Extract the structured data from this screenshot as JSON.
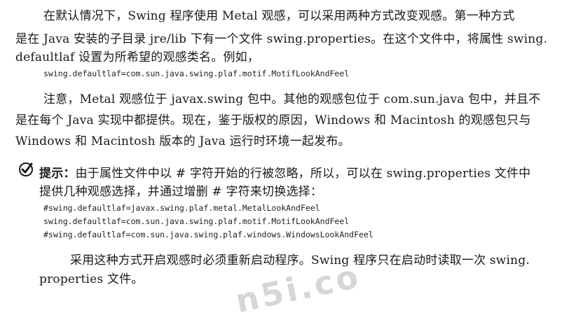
{
  "paragraph1": {
    "line1": "在默认情况下，Swing 程序使用 Metal 观感，可以采用两种方式改变观感。第一种方式",
    "line2": "是在 Java 安装的子目录 jre/lib 下有一个文件 swing.properties。在这个文件中，将属性 swing.",
    "line3": "defaultlaf 设置为所希望的观感类名。例如，"
  },
  "code1": "swing.defaultlaf=com.sun.java.swing.plaf.motif.MotifLookAndFeel",
  "paragraph2": {
    "line1": "注意，Metal 观感位于 javax.swing 包中。其他的观感包位于 com.sun.java 包中，并且不",
    "line2": "是在每个 Java 实现中都提供。现在，鉴于版权的原因，Windows 和 Macintosh 的观感包只与",
    "line3": "Windows 和 Macintosh 版本的 Java 运行时环境一起发布。"
  },
  "tip": {
    "icon": "checkmark-icon",
    "title": "提示：",
    "line1": "由于属性文件中以 # 字符开始的行被忽略，所以，可以在 swing.properties 文件中",
    "line2": "提供几种观感选择，并通过增删 # 字符来切换选择：",
    "code": [
      "#swing.defaultlaf=javax.swing.plaf.metal.MetalLookAndFeel",
      "swing.defaultlaf=com.sun.java.swing.plaf.motif.MotifLookAndFeel",
      "#swing.defaultlaf=com.sun.java.swing.plaf.windows.WindowsLookAndFeel"
    ],
    "para_line1": "采用这种方式开启观感时必须重新启动程序。Swing 程序只在启动时读取一次 swing.",
    "para_line2": "properties 文件。"
  },
  "watermark": "n5i.co"
}
